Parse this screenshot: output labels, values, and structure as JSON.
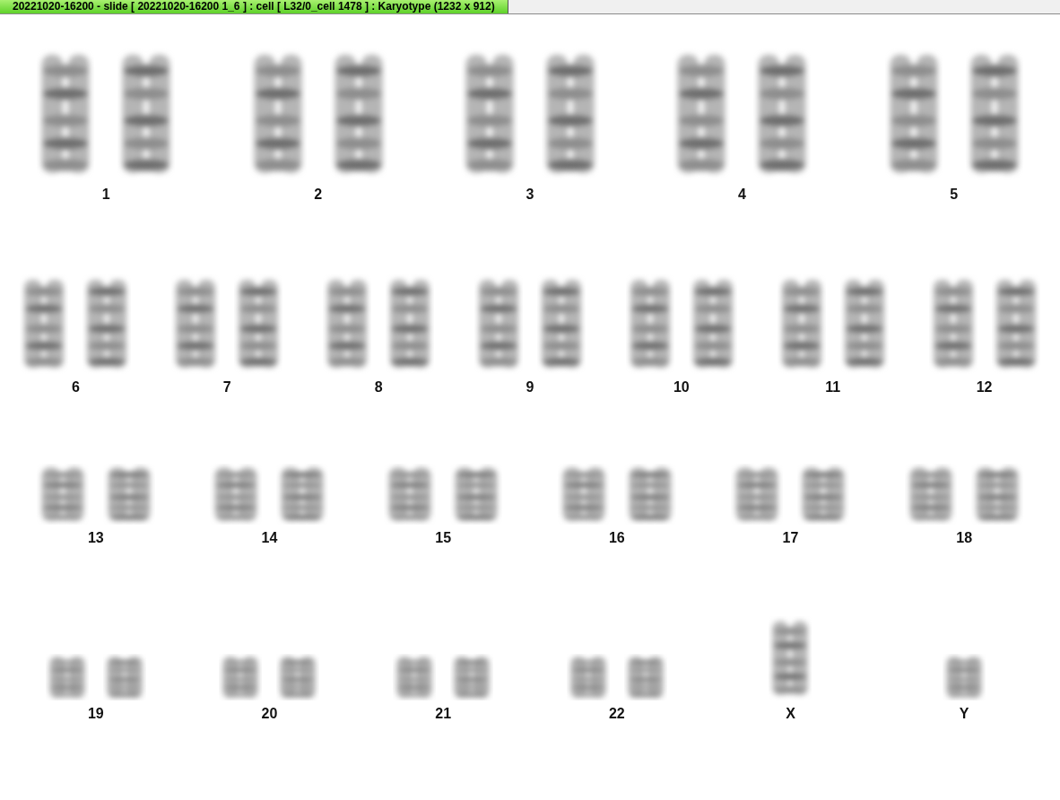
{
  "title": "20221020-16200 - slide [ 20221020-16200 1_6 ] : cell [ L32/0_cell 1478 ] : Karyotype  (1232 x 912)",
  "rows": [
    {
      "groups": [
        {
          "label": "1",
          "kind": "pair"
        },
        {
          "label": "2",
          "kind": "pair"
        },
        {
          "label": "3",
          "kind": "pair"
        },
        {
          "label": "4",
          "kind": "pair"
        },
        {
          "label": "5",
          "kind": "pair"
        }
      ]
    },
    {
      "groups": [
        {
          "label": "6",
          "kind": "pair"
        },
        {
          "label": "7",
          "kind": "pair"
        },
        {
          "label": "8",
          "kind": "pair"
        },
        {
          "label": "9",
          "kind": "pair"
        },
        {
          "label": "10",
          "kind": "pair"
        },
        {
          "label": "11",
          "kind": "pair"
        },
        {
          "label": "12",
          "kind": "pair"
        }
      ]
    },
    {
      "groups": [
        {
          "label": "13",
          "kind": "pair"
        },
        {
          "label": "14",
          "kind": "pair"
        },
        {
          "label": "15",
          "kind": "pair"
        },
        {
          "label": "16",
          "kind": "pair"
        },
        {
          "label": "17",
          "kind": "pair"
        },
        {
          "label": "18",
          "kind": "pair"
        }
      ]
    },
    {
      "groups": [
        {
          "label": "19",
          "kind": "pair"
        },
        {
          "label": "20",
          "kind": "pair"
        },
        {
          "label": "21",
          "kind": "pair"
        },
        {
          "label": "22",
          "kind": "pair"
        },
        {
          "label": "X",
          "kind": "single"
        },
        {
          "label": "Y",
          "kind": "single"
        }
      ]
    }
  ]
}
